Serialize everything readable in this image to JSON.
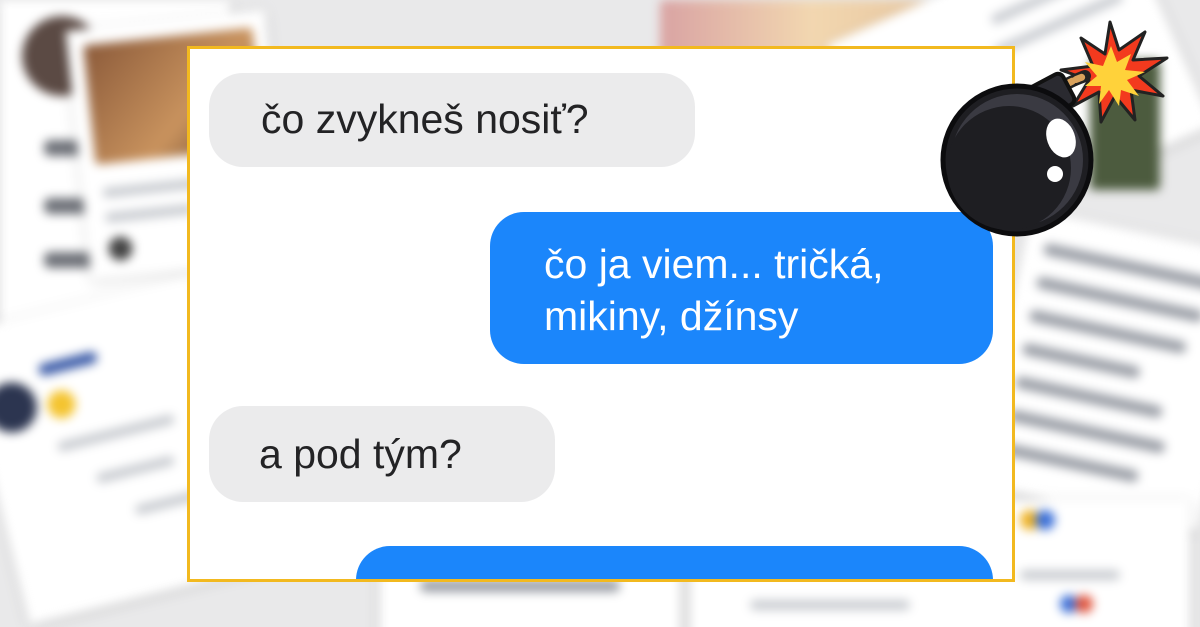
{
  "chat": {
    "messages": [
      {
        "direction": "incoming",
        "text": "čo zvykneš nosiť?"
      },
      {
        "direction": "outgoing",
        "text": "čo ja viem... tričká,\nmikiny, džínsy"
      },
      {
        "direction": "incoming",
        "text": "a pod tým?"
      },
      {
        "direction": "outgoing",
        "text": ""
      }
    ]
  },
  "colors": {
    "frame_border": "#f2b91f",
    "incoming_bubble": "#ebebec",
    "outgoing_bubble": "#1b86fb",
    "bomb": "#1e1e22",
    "explosion": "#f33a1e"
  },
  "decorations": {
    "bomb_icon": "bomb-icon",
    "background": "blurred-social-media-comment-collage"
  }
}
